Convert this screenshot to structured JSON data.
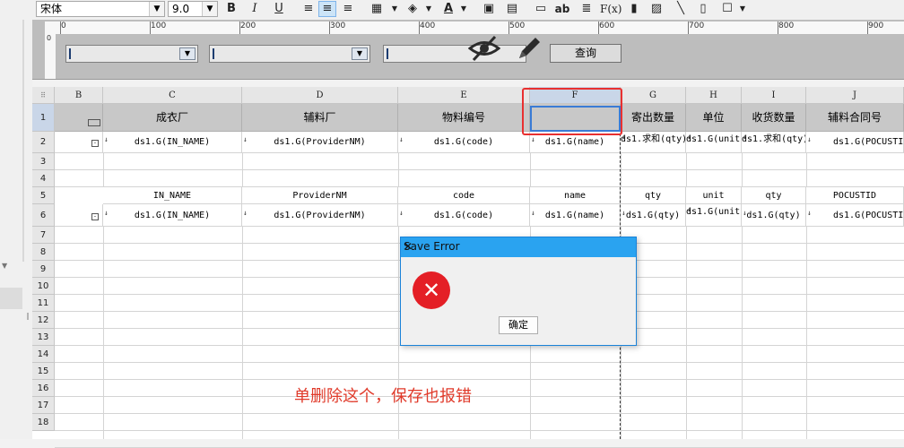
{
  "toolbar": {
    "font_name": "宋体",
    "font_size": "9.0",
    "bold": "B",
    "italic": "I",
    "underline": "U",
    "text_color_letter": "A",
    "ab_label": "ab",
    "fx_label": "F(x)"
  },
  "ruler": {
    "ticks": [
      "0",
      "100",
      "200",
      "300",
      "400",
      "500",
      "600",
      "700",
      "800",
      "900"
    ]
  },
  "param_panel": {
    "query_button": "查询"
  },
  "grid": {
    "columns": [
      "B",
      "C",
      "D",
      "E",
      "F",
      "G",
      "H",
      "I",
      "J"
    ],
    "rows": [
      "1",
      "2",
      "3",
      "4",
      "5",
      "6",
      "7",
      "8",
      "9",
      "10",
      "11",
      "12",
      "13",
      "14",
      "15",
      "16",
      "17",
      "18"
    ],
    "row1": [
      "",
      "成衣厂",
      "辅料厂",
      "物料编号",
      "",
      "寄出数量",
      "单位",
      "收货数量",
      "辅料合同号"
    ],
    "row2": [
      "",
      "ds1.G(IN_NAME)",
      "ds1.G(ProviderNM)",
      "ds1.G(code)",
      "ds1.G(name)",
      "ds1.求和(qty)",
      "ds1.G(unit)",
      "ds1.求和(qty)",
      "ds1.G(POCUSTID)"
    ],
    "row5": [
      "",
      "IN_NAME",
      "ProviderNM",
      "code",
      "name",
      "qty",
      "unit",
      "qty",
      "POCUSTID"
    ],
    "row6": [
      "",
      "ds1.G(IN_NAME)",
      "ds1.G(ProviderNM)",
      "ds1.G(code)",
      "ds1.G(name)",
      "ds1.G(qty)",
      "ds1.G(unit)",
      "ds1.G(qty)",
      "ds1.G(POCUSTID)"
    ]
  },
  "annotation": "单删除这个，保存也报错",
  "dialog": {
    "title": "Save Error",
    "close": "✕",
    "error_icon": "error-x-icon",
    "ok_button": "确定"
  },
  "colors": {
    "accent": "#2aa3f0",
    "error": "#e41f26",
    "annotation": "#e03a2a"
  }
}
